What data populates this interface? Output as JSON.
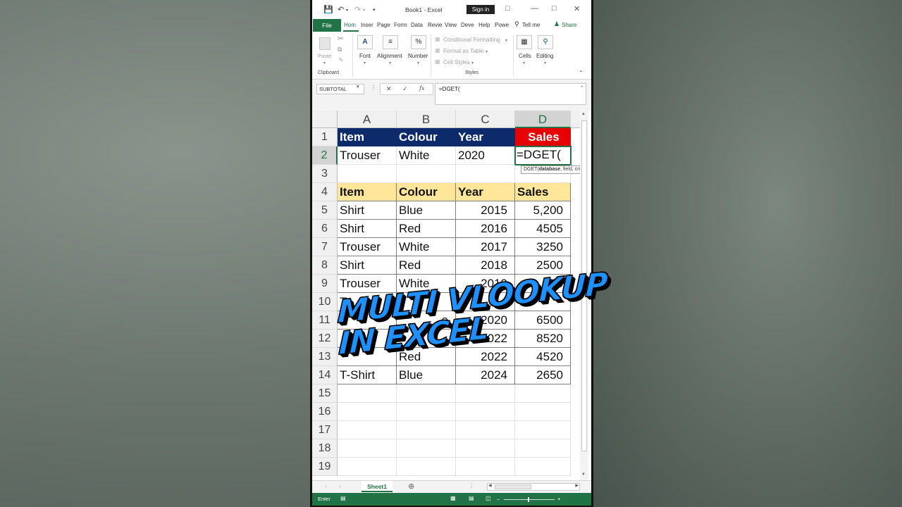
{
  "window": {
    "title": "Book1 - Excel",
    "sign_in": "Sign in"
  },
  "tabs": {
    "file": "File",
    "items": [
      "Hom",
      "Inser",
      "Page",
      "Form",
      "Data",
      "Revie",
      "View",
      "Deve",
      "Help",
      "Powe"
    ],
    "tell_me": "Tell me",
    "share": "Share"
  },
  "ribbon": {
    "paste": "Paste",
    "clipboard": "Clipboard",
    "font": "Font",
    "alignment": "Alignment",
    "number": "Number",
    "conditional_formatting": "Conditional Formatting",
    "format_as_table": "Format as Table",
    "cell_styles": "Cell Styles",
    "styles": "Styles",
    "cells": "Cells",
    "editing": "Editing"
  },
  "formula_bar": {
    "name_box": "SUBTOTAL",
    "formula": "=DGET("
  },
  "columns": [
    "A",
    "B",
    "C",
    "D"
  ],
  "rows": [
    "1",
    "2",
    "3",
    "4",
    "5",
    "6",
    "7",
    "8",
    "9",
    "10",
    "11",
    "12",
    "13",
    "14",
    "15",
    "16",
    "17",
    "18",
    "19"
  ],
  "criteria": {
    "headers": [
      "Item",
      "Colour",
      "Year",
      "Sales"
    ],
    "values": [
      "Trouser",
      "White",
      "2020",
      "=DGET("
    ]
  },
  "tooltip": {
    "func": "DGET(",
    "arg1": "database",
    "rest": ", field, crit"
  },
  "table": {
    "headers": [
      "Item",
      "Colour",
      "Year",
      "Sales"
    ],
    "rows": [
      [
        "Shirt",
        "Blue",
        "2015",
        "5,200"
      ],
      [
        "Shirt",
        "Red",
        "2016",
        "4505"
      ],
      [
        "Trouser",
        "White",
        "2017",
        "3250"
      ],
      [
        "Shirt",
        "Red",
        "2018",
        "2500"
      ],
      [
        "Trouser",
        "White",
        "2019",
        "15"
      ],
      [
        "Tr",
        "",
        "",
        ""
      ],
      [
        "",
        "e",
        "2020",
        "6500"
      ],
      [
        "",
        "",
        "2022",
        "8520"
      ],
      [
        "",
        "Red",
        "2022",
        "4520"
      ],
      [
        "T-Shirt",
        "Blue",
        "2024",
        "2650"
      ]
    ]
  },
  "sheet": {
    "tab": "Sheet1"
  },
  "status": {
    "mode": "Enter"
  },
  "overlay": {
    "line1": "MULTI VLOOKUP",
    "line2": "IN EXCEL"
  },
  "colors": {
    "excel_green": "#217346",
    "header_navy": "#0d2b6b",
    "header_red": "#e60000",
    "table_header_yellow": "#ffe699",
    "overlay_blue": "#1e90ff"
  }
}
